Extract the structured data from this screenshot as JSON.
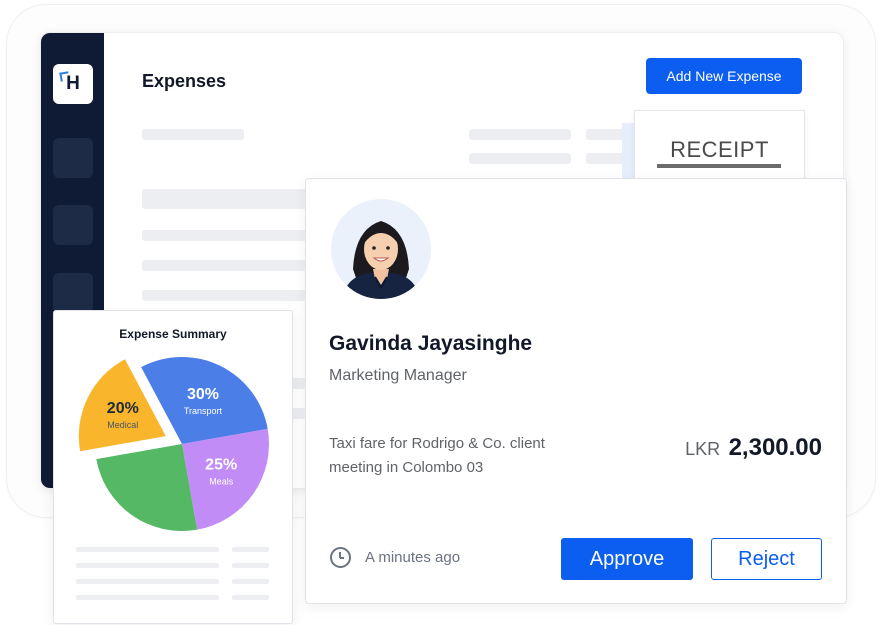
{
  "app": {
    "title": "Expenses",
    "add_button": "Add New Expense",
    "logo_letter": "H",
    "brand_color": "#0b5ef0",
    "sidebar_color": "#0f1b34"
  },
  "receipt": {
    "title": "RECEIPT"
  },
  "request": {
    "name": "Gavinda Jayasinghe",
    "role": "Marketing Manager",
    "description": "Taxi fare for Rodrigo & Co. client meeting in Colombo 03",
    "currency": "LKR",
    "amount": "2,300.00",
    "time": "A minutes ago",
    "approve_label": "Approve",
    "reject_label": "Reject"
  },
  "summary": {
    "title": "Expense Summary"
  },
  "chart_data": {
    "type": "pie",
    "title": "Expense Summary",
    "slices": [
      {
        "label": "Transport",
        "value": 30,
        "display": "30%",
        "color": "#4b7ee6"
      },
      {
        "label": "Meals",
        "value": 25,
        "display": "25%",
        "color": "#c18cf5"
      },
      {
        "label": "",
        "value": 25,
        "display": "",
        "color": "#55b865"
      },
      {
        "label": "Medical",
        "value": 20,
        "display": "20%",
        "color": "#f9b52c",
        "exploded": true
      }
    ]
  }
}
